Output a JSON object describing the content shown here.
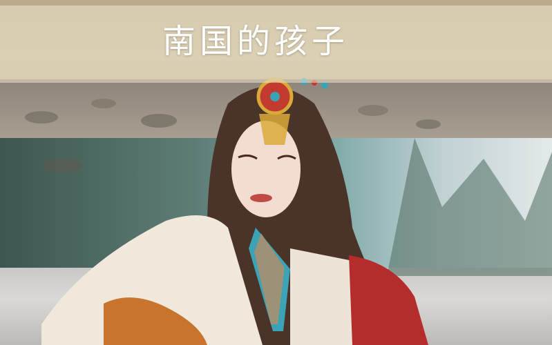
{
  "caption": {
    "title": "南国的孩子"
  },
  "colors": {
    "hair": "#4a3328",
    "jacket": "#efe8db",
    "red_sleeve": "#b52c2c",
    "turquoise": "#3aa3b5",
    "guitar": "#c8742c"
  }
}
